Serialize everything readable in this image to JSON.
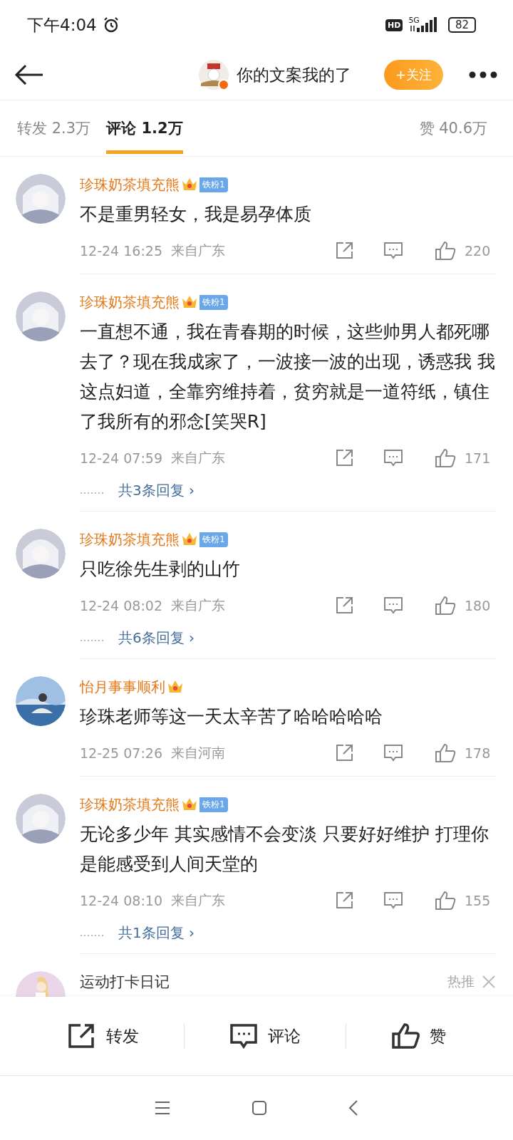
{
  "status_bar": {
    "time": "下午4:04",
    "hd": "HD",
    "network": "5G",
    "battery": "82"
  },
  "header": {
    "title": "你的文案我的了",
    "follow_label": "+关注"
  },
  "tabs": [
    {
      "label": "转发 2.3万",
      "selected": false
    },
    {
      "label": "评论 1.2万",
      "selected": true
    }
  ],
  "likes_tab": "赞 40.6万",
  "comments": [
    {
      "name": "珍珠奶茶填充熊",
      "fan_badge": "铁粉1",
      "text": "不是重男轻女，我是易孕体质",
      "time": "12-24 16:25",
      "location": "来自广东",
      "likes": "220"
    },
    {
      "name": "珍珠奶茶填充熊",
      "fan_badge": "铁粉1",
      "text": "一直想不通，我在青春期的时候，这些帅男人都死哪去了？现在我成家了，一波接一波的出现，诱惑我 我这点妇道，全靠穷维持着，贫穷就是一道符纸，镇住了我所有的邪念[笑哭R]",
      "time": "12-24 07:59",
      "location": "来自广东",
      "likes": "171",
      "replies": "共3条回复 ›"
    },
    {
      "name": "珍珠奶茶填充熊",
      "fan_badge": "铁粉1",
      "text": "只吃徐先生剥的山竹",
      "time": "12-24 08:02",
      "location": "来自广东",
      "likes": "180",
      "replies": "共6条回复 ›"
    },
    {
      "name": "怡月事事顺利",
      "text": "珍珠老师等这一天太辛苦了哈哈哈哈哈",
      "time": "12-25 07:26",
      "location": "来自河南",
      "likes": "178"
    },
    {
      "name": "珍珠奶茶填充熊",
      "fan_badge": "铁粉1",
      "text": "无论多少年 其实感情不会变淡 只要好好维护 打理你是能感受到人间天堂的",
      "time": "12-24 08:10",
      "location": "来自广东",
      "likes": "155",
      "replies": "共1条回复 ›"
    }
  ],
  "promoted": {
    "name": "运动打卡日记",
    "tag": "热推"
  },
  "bottom_bar": [
    {
      "kind": "repost",
      "label": "转发"
    },
    {
      "kind": "comment",
      "label": "评论"
    },
    {
      "kind": "like",
      "label": "赞"
    }
  ]
}
